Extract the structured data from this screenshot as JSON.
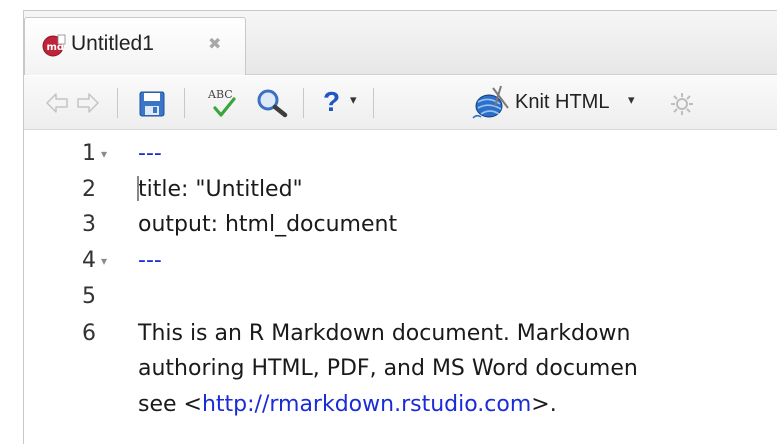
{
  "tab": {
    "title": "Untitled1",
    "close_glyph": "✖",
    "icon": "rmarkdown-file-icon"
  },
  "toolbar": {
    "back_icon": "back-arrow-icon",
    "forward_icon": "forward-arrow-icon",
    "save_icon": "save-icon",
    "spellcheck_icon": "spellcheck-icon",
    "spellcheck_text": "ABC",
    "find_icon": "magnifier-icon",
    "help_label": "?",
    "help_dropdown": "▾",
    "knit_label": "Knit HTML",
    "knit_dropdown": "▾",
    "settings_icon": "gear-icon"
  },
  "editor": {
    "lines": [
      {
        "number": "1",
        "fold": "▾",
        "text": "---"
      },
      {
        "number": "2",
        "fold": "",
        "text": "title: \"Untitled\""
      },
      {
        "number": "3",
        "fold": "",
        "text": "output: html_document"
      },
      {
        "number": "4",
        "fold": "▾",
        "text": "---"
      },
      {
        "number": "5",
        "fold": "",
        "text": ""
      },
      {
        "number": "6",
        "fold": "",
        "text": "This is an R Markdown document. Markdown"
      },
      {
        "number": "",
        "fold": "",
        "text": "authoring HTML, PDF, and MS Word documen"
      },
      {
        "number": "",
        "fold": "",
        "text_before": "see <",
        "link": "http://rmarkdown.rstudio.com",
        "text_after": ">."
      }
    ]
  },
  "colors": {
    "link": "#1a2bd8",
    "text": "#1a1a1a",
    "gutter": "#333333",
    "toolbar_bg": "#eeeeee",
    "knit_accent": "#2a6fc9",
    "help_accent": "#1f56c4",
    "save_accent": "#3a76c8"
  }
}
